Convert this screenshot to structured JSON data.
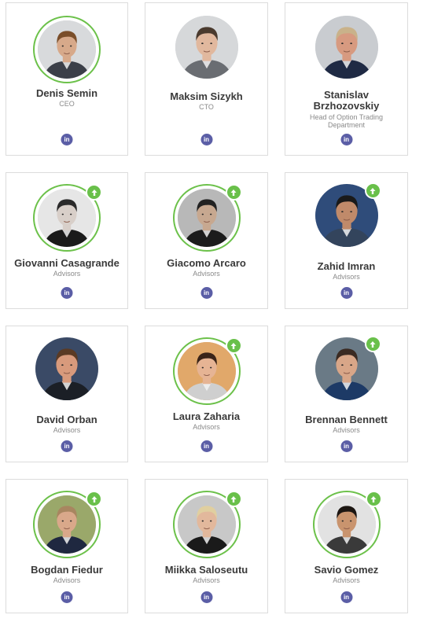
{
  "team": [
    {
      "name": "Denis Semin",
      "role": "CEO",
      "badge": false,
      "ring": true,
      "skin": "#d7a98a",
      "hair": "#7a4e2a",
      "bg": "#d8dadc",
      "shirt": "#3b3f48"
    },
    {
      "name": "Maksim Sizykh",
      "role": "CTO",
      "badge": false,
      "ring": false,
      "skin": "#e1b89e",
      "hair": "#4a3a2e",
      "bg": "#d6d8da",
      "shirt": "#6a6d72"
    },
    {
      "name": "Stanislav Brzhozovskiy",
      "role": "Head of Option Trading Department",
      "badge": false,
      "ring": false,
      "skin": "#d79a80",
      "hair": "#c9b28a",
      "bg": "#c9ccd0",
      "shirt": "#1f2a44"
    },
    {
      "name": "Giovanni Casagrande",
      "role": "Advisors",
      "badge": true,
      "ring": true,
      "skin": "#d8cfc9",
      "hair": "#2a2a2a",
      "bg": "#e6e6e6",
      "shirt": "#1a1a1a"
    },
    {
      "name": "Giacomo Arcaro",
      "role": "Advisors",
      "badge": true,
      "ring": true,
      "skin": "#c7a890",
      "hair": "#222222",
      "bg": "#b8b8b8",
      "shirt": "#1c1c1c"
    },
    {
      "name": "Zahid Imran",
      "role": "Advisors",
      "badge": true,
      "ring": false,
      "skin": "#c08a6a",
      "hair": "#1a1a1a",
      "bg": "#2f4c7a",
      "shirt": "#33445c"
    },
    {
      "name": "David Orban",
      "role": "Advisors",
      "badge": false,
      "ring": false,
      "skin": "#d89a7c",
      "hair": "#5a3a24",
      "bg": "#3a4a66",
      "shirt": "#1b1f26"
    },
    {
      "name": "Laura Zaharia",
      "role": "Advisors",
      "badge": true,
      "ring": true,
      "skin": "#e6b494",
      "hair": "#3a2418",
      "bg": "#e1a86a",
      "shirt": "#cfcfcf"
    },
    {
      "name": "Brennan Bennett",
      "role": "Advisors",
      "badge": true,
      "ring": false,
      "skin": "#d8a688",
      "hair": "#3a2a22",
      "bg": "#6a7a86",
      "shirt": "#1d3a66"
    },
    {
      "name": "Bogdan Fiedur",
      "role": "Advisors",
      "badge": true,
      "ring": true,
      "skin": "#d9a88a",
      "hair": "#a88660",
      "bg": "#9aa86a",
      "shirt": "#1f2840"
    },
    {
      "name": "Miikka Saloseutu",
      "role": "Advisors",
      "badge": true,
      "ring": true,
      "skin": "#e2b89c",
      "hair": "#e0cfa0",
      "bg": "#c8c8c8",
      "shirt": "#1a1a1a"
    },
    {
      "name": "Savio Gomez",
      "role": "Advisors",
      "badge": true,
      "ring": true,
      "skin": "#c9946e",
      "hair": "#1c1612",
      "bg": "#e2e2e2",
      "shirt": "#3a3a3a"
    }
  ],
  "linkedin_label": "in"
}
